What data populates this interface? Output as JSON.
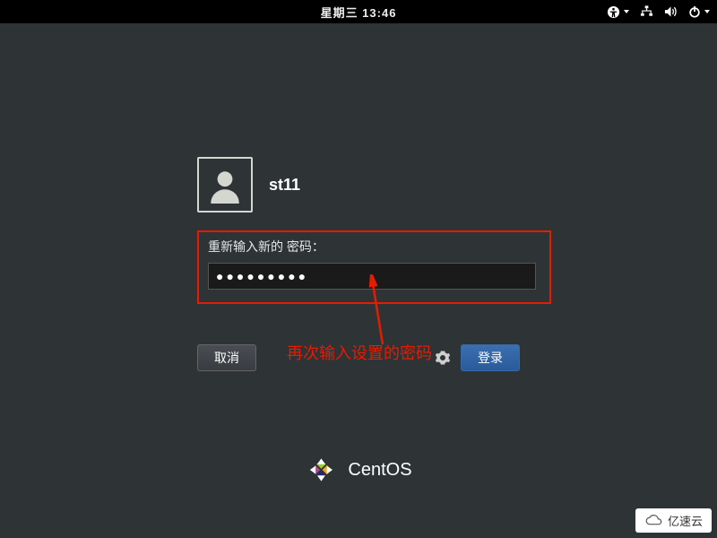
{
  "topbar": {
    "clock": "星期三 13:46"
  },
  "login": {
    "username": "st11",
    "password_label": "重新输入新的 密码：",
    "password_value": "●●●●●●●●●",
    "cancel_label": "取消",
    "login_label": "登录"
  },
  "annotation": {
    "text": "再次输入设置的密码"
  },
  "footer": {
    "brand": "CentOS"
  },
  "watermark": {
    "text": "亿速云"
  }
}
